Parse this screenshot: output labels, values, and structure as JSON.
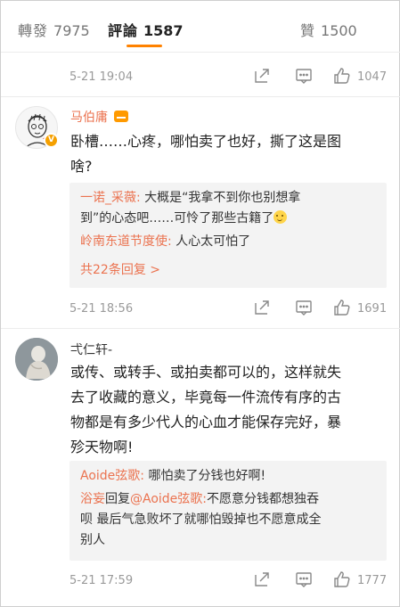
{
  "tabs": {
    "repost": {
      "label": "轉發",
      "count": "7975"
    },
    "comment": {
      "label": "評論",
      "count": "1587"
    },
    "like": {
      "label": "贊",
      "count": "1500"
    }
  },
  "colors": {
    "accent": "#ff8200",
    "name_highlight": "#eb7350",
    "reply_bg": "#f3f3f3"
  },
  "prev_comment": {
    "time": "5-21 19:04",
    "likes": "1047"
  },
  "comments": [
    {
      "username": "马伯庸",
      "badge": "V",
      "avatar_icon": "sketch-portrait-avatar",
      "text_lines": [
        "卧槽……心疼，哪怕卖了也好，撕了这是图",
        "啥?"
      ],
      "replies": [
        {
          "name": "一诺_采薇:",
          "text": " 大概是“我拿不到你也别想拿"
        },
        {
          "name": "",
          "text": "到”的心态吧……可怜了那些古籍了"
        },
        {
          "name": "岭南东道节度使:",
          "text": " 人心太可怕了"
        }
      ],
      "more_replies": "共22条回复 >",
      "time": "5-21 18:56",
      "likes": "1691"
    },
    {
      "username": "弌仁轩-",
      "avatar_icon": "statue-avatar",
      "text_lines": [
        "或传、或转手、或拍卖都可以的，这样就失",
        "去了收藏的意义，毕竟每一件流传有序的古",
        "物都是有多少代人的心血才能保存完好，暴",
        "殄天物啊!"
      ],
      "replies": [
        {
          "name": "Aoide弦歌:",
          "text": " 哪怕卖了分钱也好啊!"
        },
        {
          "prefix": "浴妄",
          "mid": "回复",
          "name": "@Aoide弦歌:",
          "text": "不愿意分钱都想独吞"
        },
        {
          "name": "",
          "text": "呗 最后气急败坏了就哪怕毁掉也不愿意成全"
        },
        {
          "name": "",
          "text": "别人"
        }
      ],
      "time": "5-21 17:59",
      "likes": "1777"
    }
  ]
}
